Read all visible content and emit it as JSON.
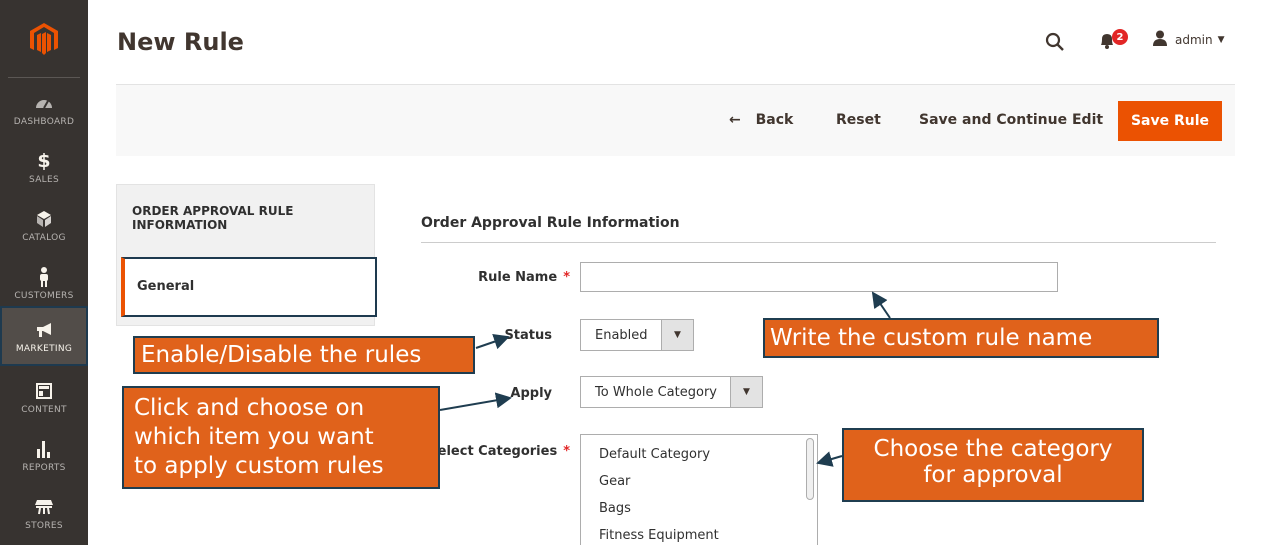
{
  "colors": {
    "sidebar_bg": "#373330",
    "accent": "#eb5202",
    "annotation_bg": "#e0621b",
    "annotation_border": "#1f3d50",
    "required": "#e22626"
  },
  "sidebar": {
    "logo_icon": "magento-logo-icon",
    "items": [
      {
        "label": "DASHBOARD",
        "icon": "dashboard-gauge-icon"
      },
      {
        "label": "SALES",
        "icon": "dollar-icon"
      },
      {
        "label": "CATALOG",
        "icon": "cube-icon"
      },
      {
        "label": "CUSTOMERS",
        "icon": "person-icon"
      },
      {
        "label": "MARKETING",
        "icon": "megaphone-icon"
      },
      {
        "label": "CONTENT",
        "icon": "layout-icon"
      },
      {
        "label": "REPORTS",
        "icon": "bar-chart-icon"
      },
      {
        "label": "STORES",
        "icon": "store-icon"
      }
    ]
  },
  "header": {
    "title": "New Rule",
    "notification_count": "2",
    "user_name": "admin"
  },
  "actions": {
    "back": "Back",
    "reset": "Reset",
    "save_continue": "Save and Continue Edit",
    "save_rule": "Save Rule"
  },
  "tabs": {
    "section_title": "ORDER APPROVAL RULE INFORMATION",
    "general": "General"
  },
  "form": {
    "section_title": "Order Approval Rule Information",
    "rule_name_label": "Rule Name",
    "rule_name_value": "",
    "status_label": "Status",
    "status_value": "Enabled",
    "apply_label": "Apply",
    "apply_value": "To Whole Category",
    "categories_label": "Select Categories",
    "required_mark": "*",
    "categories": [
      "Default Category",
      "Gear",
      "Bags",
      "Fitness Equipment"
    ]
  },
  "annotations": {
    "enable": "Enable/Disable the rules",
    "click": [
      "Click and choose on",
      "which item you want",
      "to apply custom rules"
    ],
    "write": "Write the custom rule name",
    "choose": [
      "Choose the category",
      "for approval"
    ]
  }
}
